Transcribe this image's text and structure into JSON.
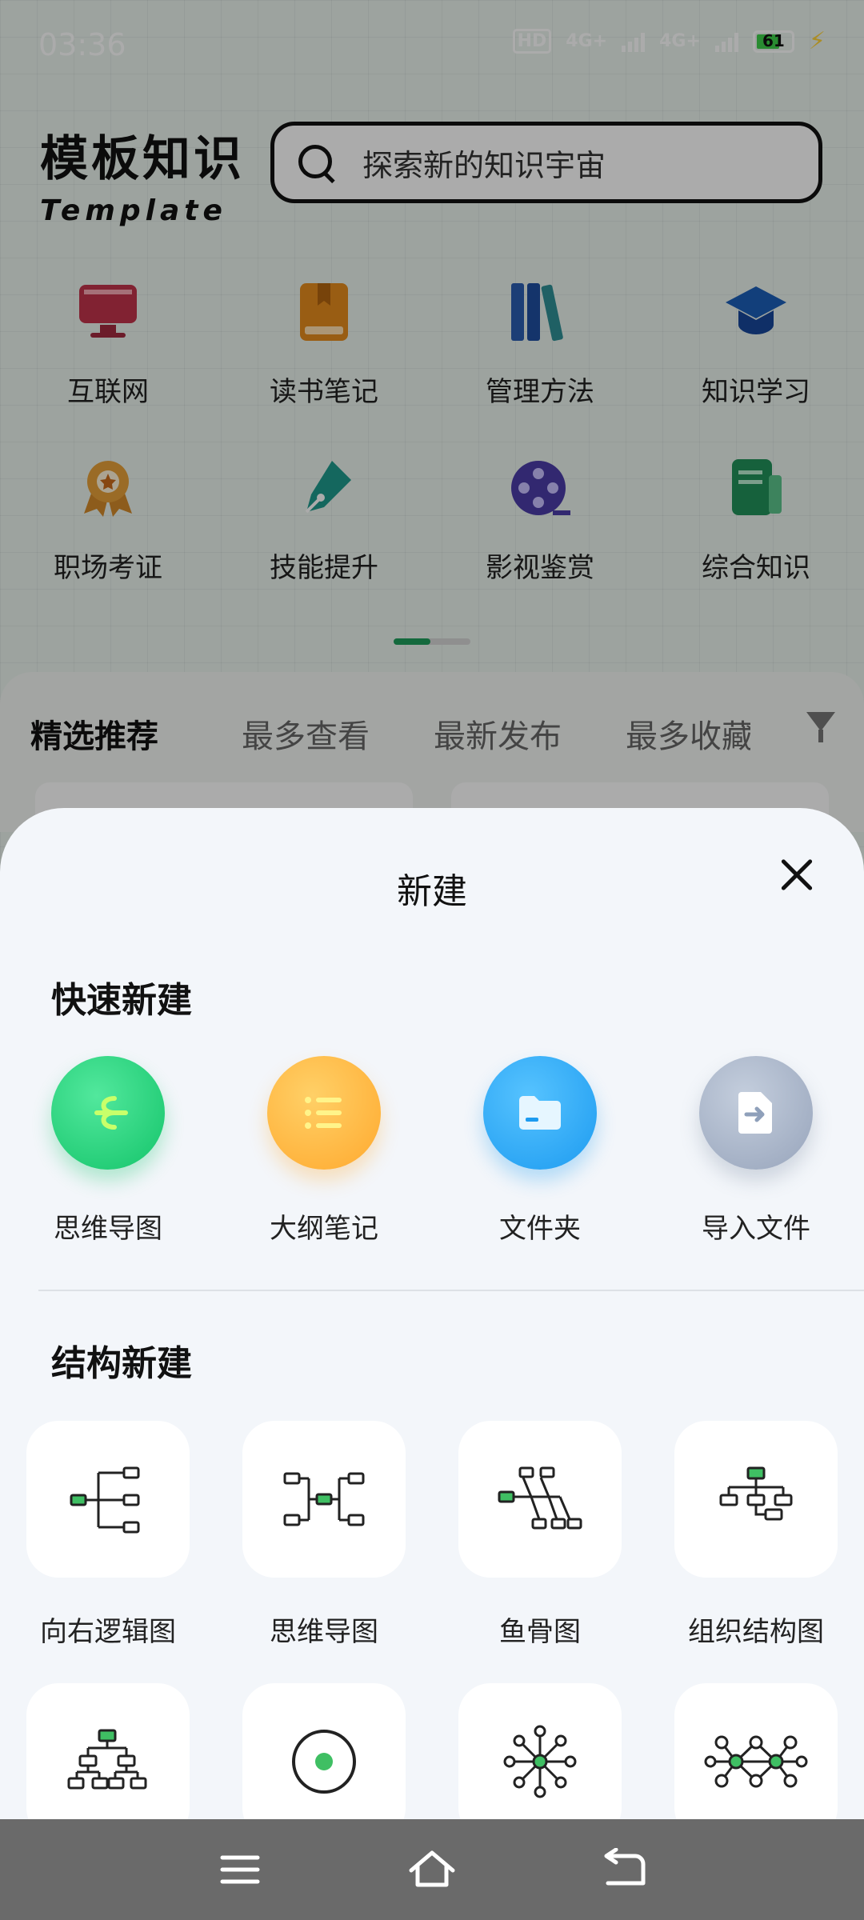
{
  "status_bar": {
    "time": "03:36",
    "network_1": "4G+",
    "network_2": "4G+",
    "hd": "HD",
    "battery_level": "61"
  },
  "header": {
    "logo_cn": "模板知识",
    "logo_en": "Template",
    "search_placeholder": "探索新的知识宇宙"
  },
  "categories": [
    {
      "label": "互联网",
      "icon": "monitor-icon",
      "color": "#c0334b"
    },
    {
      "label": "读书笔记",
      "icon": "book-icon",
      "color": "#e58b1d"
    },
    {
      "label": "管理方法",
      "icon": "books-icon",
      "color": "#2a5db0"
    },
    {
      "label": "知识学习",
      "icon": "graduation-cap-icon",
      "color": "#1c5fb8"
    },
    {
      "label": "职场考证",
      "icon": "medal-icon",
      "color": "#d3892a"
    },
    {
      "label": "技能提升",
      "icon": "pen-icon",
      "color": "#1f9a8c"
    },
    {
      "label": "影视鉴赏",
      "icon": "film-reel-icon",
      "color": "#4b3ca8"
    },
    {
      "label": "综合知识",
      "icon": "document-icon",
      "color": "#22915a"
    }
  ],
  "feed_tabs": [
    "精选推荐",
    "最多查看",
    "最新发布",
    "最多收藏"
  ],
  "sheet": {
    "title": "新建",
    "quick_title": "快速新建",
    "quick_items": [
      {
        "label": "思维导图",
        "icon": "mindmap-icon",
        "color": "#1fcf78"
      },
      {
        "label": "大纲笔记",
        "icon": "outline-list-icon",
        "color": "#ffb338"
      },
      {
        "label": "文件夹",
        "icon": "folder-icon",
        "color": "#2aa6f3"
      },
      {
        "label": "导入文件",
        "icon": "import-file-icon",
        "color": "#9eaac0"
      }
    ],
    "struct_title": "结构新建",
    "struct_items": [
      {
        "label": "向右逻辑图",
        "icon": "right-logic-icon"
      },
      {
        "label": "思维导图",
        "icon": "mindmap-structure-icon"
      },
      {
        "label": "鱼骨图",
        "icon": "fishbone-icon"
      },
      {
        "label": "组织结构图",
        "icon": "org-chart-icon"
      },
      {
        "label": "",
        "icon": "tree-chart-icon"
      },
      {
        "label": "",
        "icon": "bubble-icon"
      },
      {
        "label": "",
        "icon": "radial-icon"
      },
      {
        "label": "",
        "icon": "network-icon"
      }
    ],
    "accent": "#3fbf63"
  }
}
